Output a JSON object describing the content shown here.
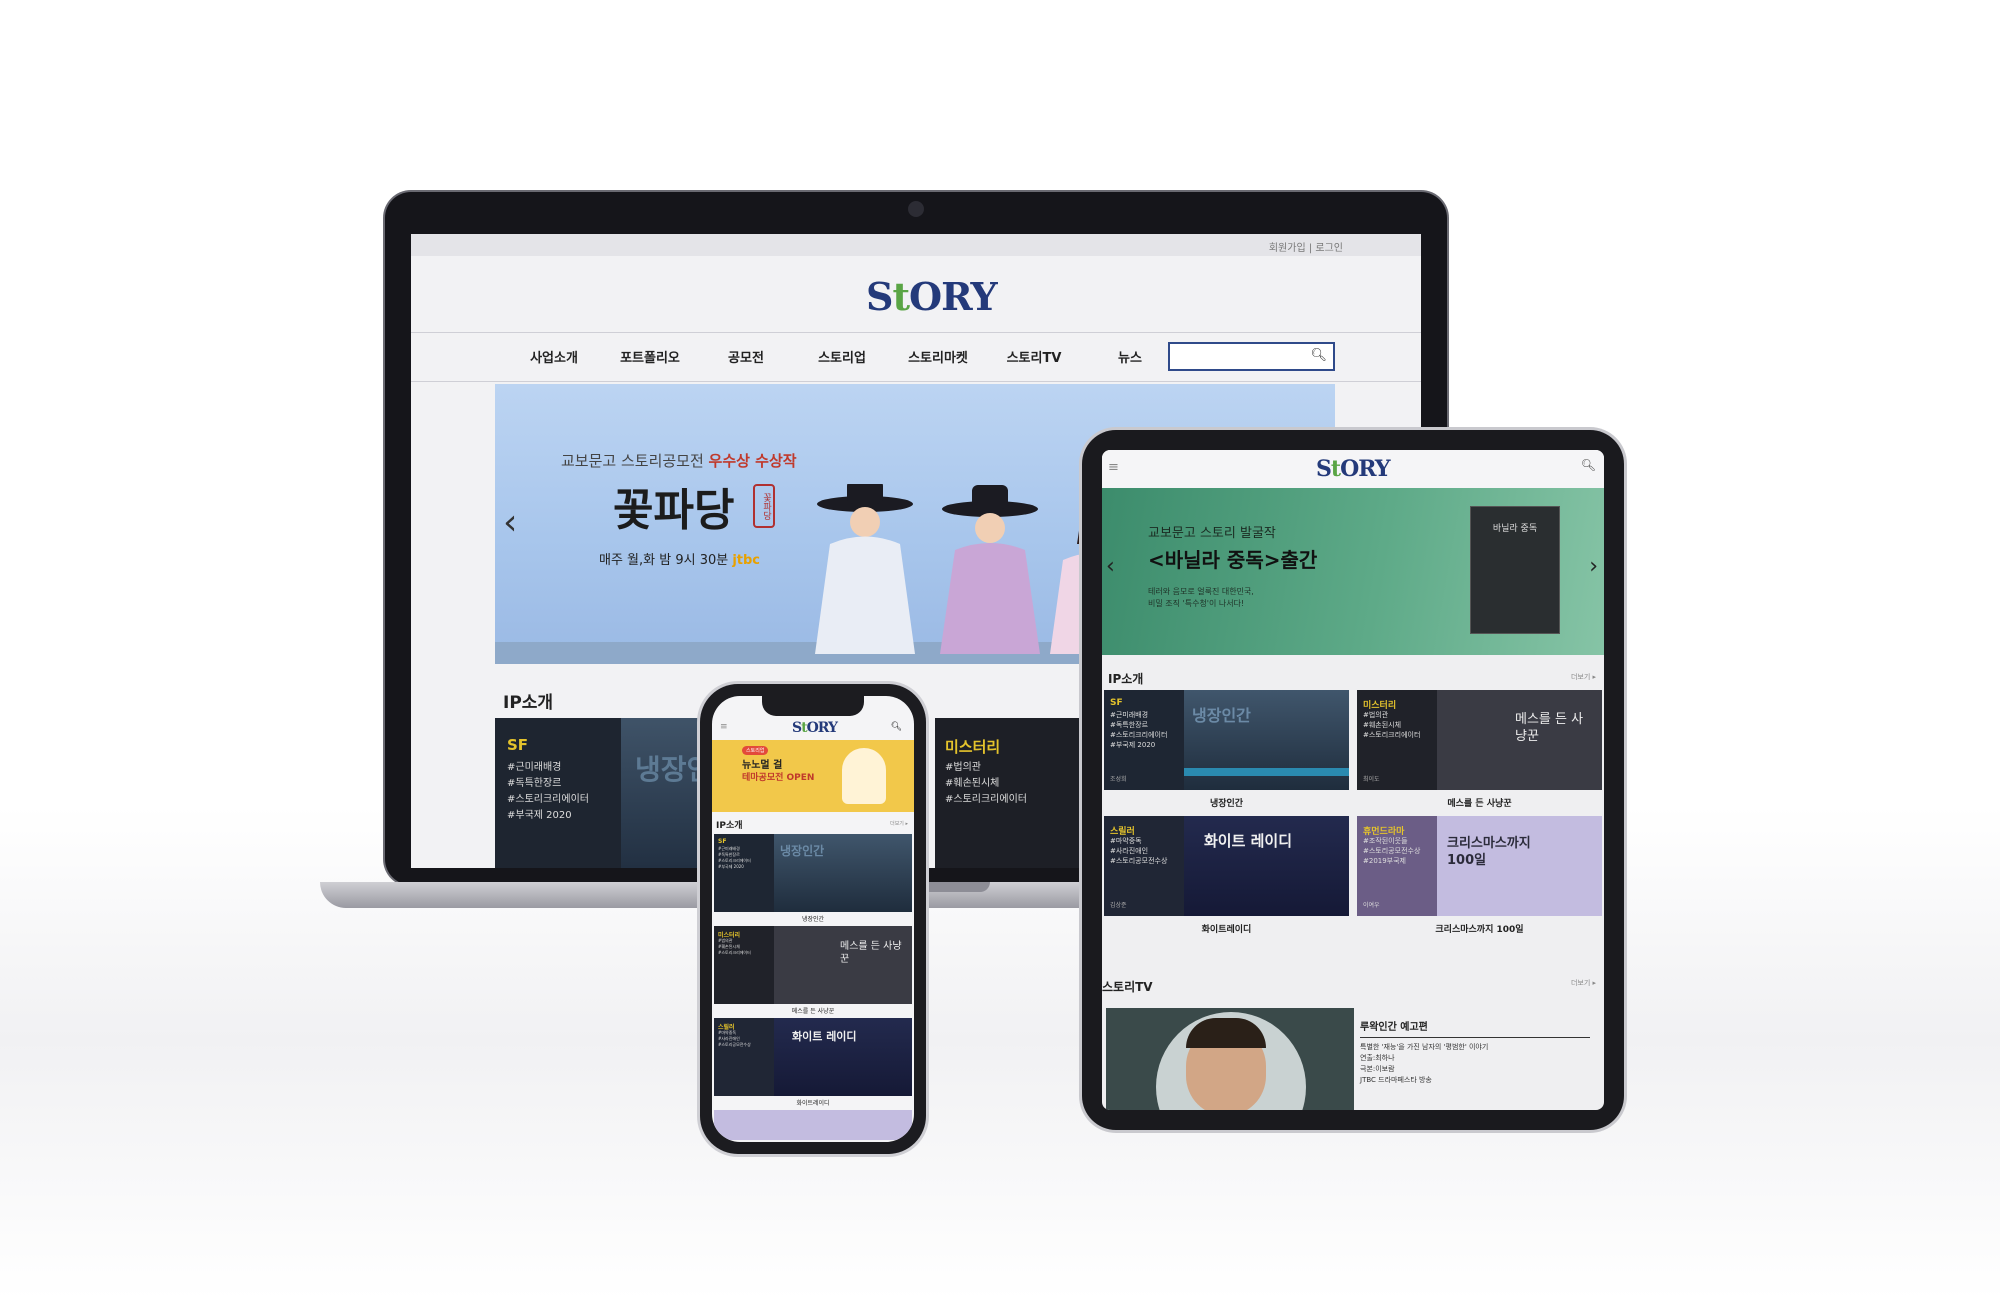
{
  "brand": {
    "logo_left": "S",
    "logo_t": "t",
    "logo_right": "ORY",
    "accent": "#2f4a8a",
    "green": "#5aa545"
  },
  "laptop": {
    "top_links": "회원가입 | 로그인",
    "nav": [
      "사업소개",
      "포트폴리오",
      "공모전",
      "스토리업",
      "스토리마켓",
      "스토리TV",
      "뉴스"
    ],
    "search_placeholder": "",
    "banner": {
      "subtitle_a": "교보문고 스토리공모전 ",
      "subtitle_b": "우수상 수상작",
      "title": "꽃파당",
      "seal": "꽃파당",
      "schedule": "매주 월,화 밤 9시 30분 ",
      "channel": "jtbc"
    },
    "ip_title": "IP소개",
    "cards": [
      {
        "category": "SF",
        "tags": [
          "#근미래배경",
          "#독특한장르",
          "#스토리크리에이터",
          "#부국제 2020"
        ],
        "image_text": "냉장인간"
      },
      {
        "category": "미스터리",
        "tags": [
          "#법의관",
          "#훼손된시체",
          "#스토리크리에이터"
        ]
      }
    ]
  },
  "tablet": {
    "banner": {
      "line1": "교보문고 스토리 발굴작",
      "line2": "<바닐라 중독>출간",
      "line3a": "테러와 음모로 얼룩진 대한민국,",
      "line3b": "비밀 조직 '특수청'이 나서다!",
      "book": "바닐라 중독"
    },
    "ip_title": "IP소개",
    "more": "더보기 ▸",
    "cards": [
      {
        "category": "SF",
        "tags": [
          "#근미래배경",
          "#독특한장르",
          "#스토리크리에이터",
          "#부국제 2020"
        ],
        "author": "조성희",
        "image_text": "냉장인간",
        "caption": "냉장인간"
      },
      {
        "category": "미스터리",
        "tags": [
          "#법의관",
          "#훼손된시체",
          "#스토리크리에이터"
        ],
        "author": "최이도",
        "image_text": "메스를 든 사냥꾼",
        "caption": "메스를 든 사냥꾼"
      },
      {
        "category": "스릴러",
        "tags": [
          "#마약중독",
          "#사라진애인",
          "#스토리공모전수상"
        ],
        "author": "김상준",
        "image_text": "화이트 레이디",
        "caption": "화이트레이디"
      },
      {
        "category": "휴먼드라마",
        "tags": [
          "#조작된이웃들",
          "#스토리공모전수상",
          "#2019부국제"
        ],
        "author": "이여우",
        "image_text": "크리스마스까지 100일",
        "caption": "크리스마스까지 100일"
      }
    ],
    "tv_title": "스토리TV",
    "tv_more": "더보기 ▸",
    "video": {
      "title": "루왁인간 예고편",
      "desc": [
        "특별한 '재능'을 가진 남자의 '평범한' 이야기",
        "연출:최하나",
        "극본:이보람",
        "JTBC 드라마페스타 방송"
      ]
    }
  },
  "phone": {
    "banner": {
      "badge": "스토리업",
      "line1": "뉴노멀 걸",
      "line2": "테마공모전 OPEN"
    },
    "ip_title": "IP소개",
    "more": "더보기 ▸",
    "cards": [
      {
        "category": "SF",
        "tags": [
          "#근미래배경",
          "#독특한장르",
          "#스토리크리에이터",
          "#부국제 2020"
        ],
        "image_text": "냉장인간",
        "caption": "냉장인간"
      },
      {
        "category": "미스터리",
        "tags": [
          "#법의관",
          "#훼손된시체",
          "#스토리크리에이터"
        ],
        "image_text": "메스를 든 사냥꾼",
        "caption": "메스를 든 사냥꾼"
      },
      {
        "category": "스릴러",
        "tags": [
          "#마약중독",
          "#사라진애인",
          "#스토리공모전수상"
        ],
        "image_text": "화이트 레이디",
        "caption": "화이트레이디"
      }
    ]
  }
}
